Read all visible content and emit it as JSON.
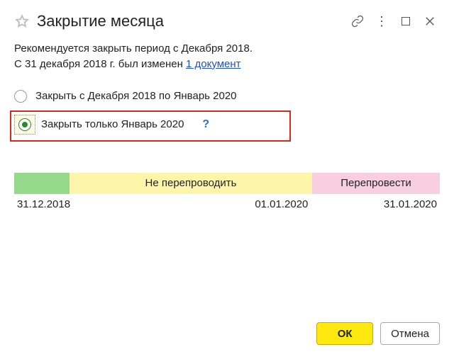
{
  "header": {
    "title": "Закрытие месяца"
  },
  "message": {
    "line1": "Рекомендуется закрыть период с Декабря 2018.",
    "line2_prefix": "С 31 декабря 2018 г. был изменен ",
    "link_text": "1 документ"
  },
  "options": {
    "range": "Закрыть с Декабря 2018 по Январь 2020",
    "only": "Закрыть только Январь 2020",
    "help": "?"
  },
  "timeline": {
    "seg_yellow_label": "Не перепроводить",
    "seg_pink_label": "Перепровести",
    "date_start": "31.12.2018",
    "date_mid": "01.01.2020",
    "date_end": "31.01.2020"
  },
  "footer": {
    "ok": "ОК",
    "cancel": "Отмена"
  }
}
